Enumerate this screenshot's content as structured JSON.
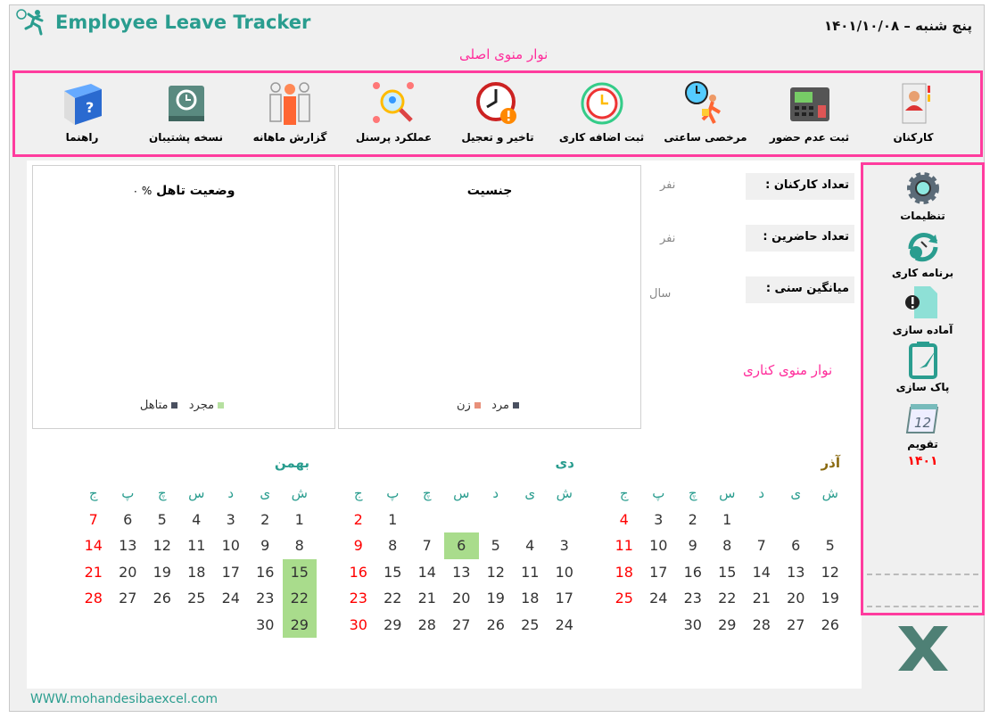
{
  "app": {
    "title": "Employee Leave Tracker",
    "date": "پنج شنبه – ۱۴۰۱/۱۰/۰۸",
    "footer": "WWW.mohandesibaexcel.com",
    "brand_color": "#2a9d8f"
  },
  "annotations": {
    "main_menu": "نوار منوی اصلی",
    "side_menu": "نوار منوی کناری"
  },
  "main_menu": [
    {
      "label": "کارکنان",
      "icon": "employee-card-icon"
    },
    {
      "label": "ثبت عدم حضور",
      "icon": "attendance-device-icon"
    },
    {
      "label": "مرخصی ساعتی",
      "icon": "hourly-leave-icon"
    },
    {
      "label": "ثبت اضافه کاری",
      "icon": "overtime-clock-icon"
    },
    {
      "label": "تاخیر و تعجیل",
      "icon": "late-clock-icon"
    },
    {
      "label": "عملکرد پرسنل",
      "icon": "personnel-search-icon"
    },
    {
      "label": "گزارش ماهانه",
      "icon": "monthly-report-icon"
    },
    {
      "label": "نسخه پشتیبان",
      "icon": "backup-icon"
    },
    {
      "label": "راهنما",
      "icon": "help-book-icon"
    }
  ],
  "side_menu": [
    {
      "label": "تنظیمات",
      "icon": "gear-icon"
    },
    {
      "label": "برنامه کاری",
      "icon": "work-schedule-icon"
    },
    {
      "label": "آماده سازی",
      "icon": "prepare-icon"
    },
    {
      "label": "پاک سازی",
      "icon": "clear-icon"
    },
    {
      "label": "تقویم",
      "icon": "calendar-icon"
    }
  ],
  "side_year": "۱۴۰۱",
  "stats": [
    {
      "label": "تعداد کارکنان :",
      "unit": "نفر"
    },
    {
      "label": "تعداد حاضرین :",
      "unit": "نفر"
    },
    {
      "label": "میانگین سنی :",
      "unit": "سال"
    }
  ],
  "charts": {
    "gender": {
      "title": "جنسیت",
      "legend": [
        {
          "name": "مرد",
          "color": "#4a5060"
        },
        {
          "name": "زن",
          "color": "#e8907a"
        }
      ]
    },
    "marital": {
      "title": "وضعیت تاهل",
      "percent": "% ۰",
      "legend": [
        {
          "name": "مجرد",
          "color": "#b6e0a0"
        },
        {
          "name": "متاهل",
          "color": "#4a5060"
        }
      ]
    }
  },
  "weekdays": [
    "ش",
    "ی",
    "د",
    "س",
    "چ",
    "پ",
    "ج"
  ],
  "calendars": [
    {
      "name": "آذر",
      "color": "#8a6a10",
      "weeks": [
        [
          null,
          null,
          null,
          1,
          2,
          3,
          4
        ],
        [
          5,
          6,
          7,
          8,
          9,
          10,
          11
        ],
        [
          12,
          13,
          14,
          15,
          16,
          17,
          18
        ],
        [
          19,
          20,
          21,
          22,
          23,
          24,
          25
        ],
        [
          26,
          27,
          28,
          29,
          30,
          null,
          null
        ]
      ],
      "highlight": []
    },
    {
      "name": "دی",
      "color": "#2a9d8f",
      "weeks": [
        [
          null,
          null,
          null,
          null,
          null,
          1,
          2
        ],
        [
          3,
          4,
          5,
          6,
          7,
          8,
          9
        ],
        [
          10,
          11,
          12,
          13,
          14,
          15,
          16
        ],
        [
          17,
          18,
          19,
          20,
          21,
          22,
          23
        ],
        [
          24,
          25,
          26,
          27,
          28,
          29,
          30
        ]
      ],
      "highlight": [
        6
      ]
    },
    {
      "name": "بهمن",
      "color": "#2a9d8f",
      "weeks": [
        [
          1,
          2,
          3,
          4,
          5,
          6,
          7
        ],
        [
          8,
          9,
          10,
          11,
          12,
          13,
          14
        ],
        [
          15,
          16,
          17,
          18,
          19,
          20,
          21
        ],
        [
          22,
          23,
          24,
          25,
          26,
          27,
          28
        ],
        [
          29,
          30,
          null,
          null,
          null,
          null,
          null
        ]
      ],
      "highlight": [
        15,
        22,
        29
      ]
    }
  ]
}
